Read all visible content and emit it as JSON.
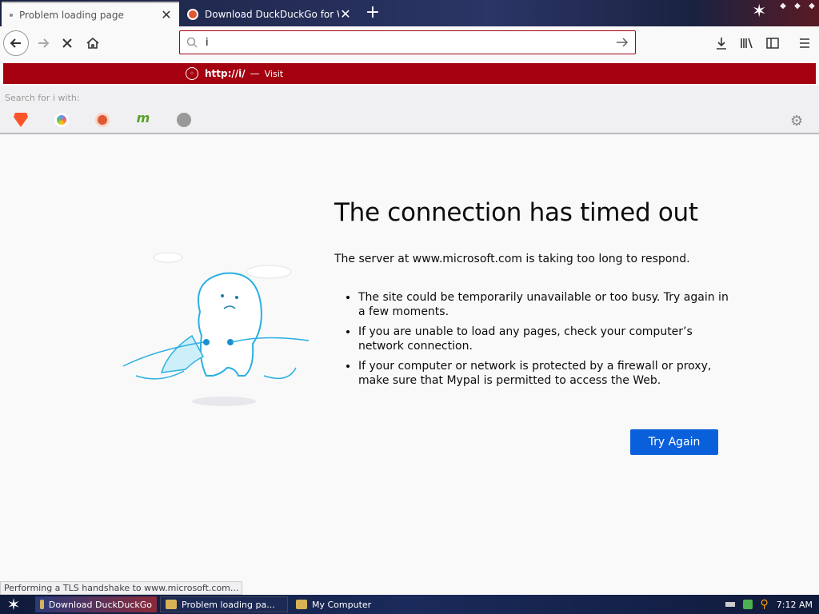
{
  "tabs": [
    {
      "title": "Problem loading page",
      "active": true
    },
    {
      "title": "Download DuckDuckGo for Windows",
      "active": false
    }
  ],
  "urlbar": {
    "value": "i"
  },
  "suggestion": {
    "url": "http://i/",
    "dash": "—",
    "action": "Visit"
  },
  "search_engines": {
    "label": "Search for i with:",
    "engines": [
      "brave-icon",
      "qwant-icon",
      "duckduckgo-icon",
      "mojeek-icon",
      "search-icon"
    ]
  },
  "error": {
    "title": "The connection has timed out",
    "description": "The server at www.microsoft.com is taking too long to respond.",
    "tips": [
      "The site could be temporarily unavailable or too busy. Try again in a few moments.",
      "If you are unable to load any pages, check your computer’s network connection.",
      "If your computer or network is protected by a firewall or proxy, make sure that Mypal is permitted to access the Web."
    ],
    "button": "Try Again"
  },
  "status": "Performing a TLS handshake to www.microsoft.com...",
  "taskbar": {
    "tasks": [
      "Download DuckDuckGo",
      "Problem loading pa...",
      "My Computer"
    ],
    "clock": "7:12 AM"
  },
  "colors": {
    "accent_red": "#a4000f",
    "button_blue": "#0a60db",
    "page_bg": "#f9f9fa"
  }
}
